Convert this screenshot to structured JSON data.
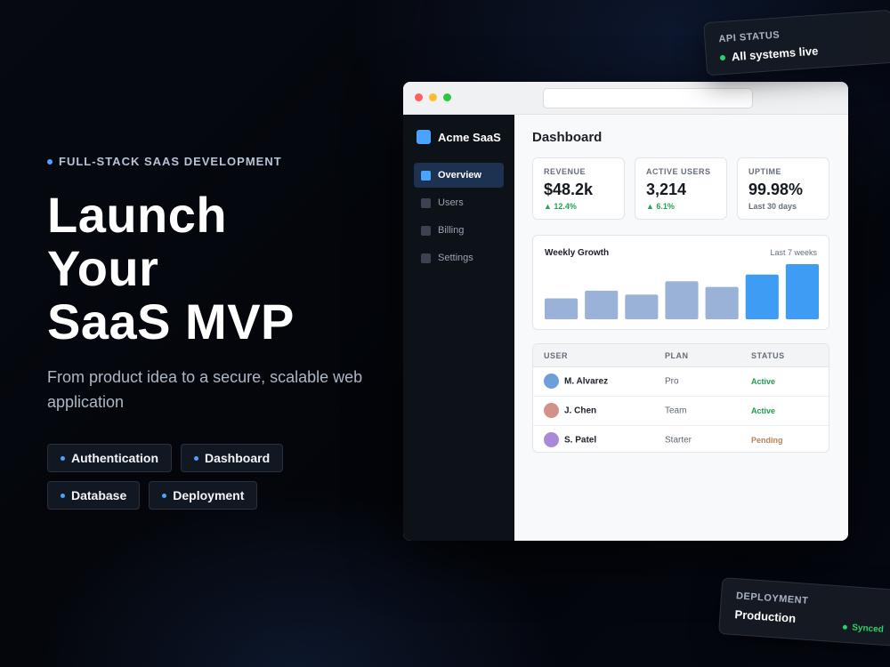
{
  "hero": {
    "eyebrow": "FULL-STACK SAAS DEVELOPMENT",
    "headline": [
      "Launch",
      "Your",
      "SaaS MVP"
    ],
    "subtitle": "From product idea to a secure, scalable web application",
    "chips": [
      "Authentication",
      "Dashboard",
      "Database",
      "Deployment"
    ]
  },
  "app": {
    "brand": "Acme SaaS",
    "nav": [
      {
        "label": "Overview",
        "icon": "overview-icon",
        "active": true
      },
      {
        "label": "Users",
        "icon": "users-icon",
        "active": false
      },
      {
        "label": "Billing",
        "icon": "billing-icon",
        "active": false
      },
      {
        "label": "Settings",
        "icon": "settings-icon",
        "active": false
      }
    ],
    "title": "Dashboard",
    "stats": [
      {
        "label": "REVENUE",
        "value": "$48.2k",
        "delta": "▲ 12.4%"
      },
      {
        "label": "ACTIVE USERS",
        "value": "3,214",
        "delta": "▲ 6.1%"
      },
      {
        "label": "UPTIME",
        "value": "99.98%",
        "delta": "Last 30 days"
      }
    ],
    "growth": {
      "title": "Weekly Growth",
      "range": "Last 7 weeks"
    },
    "table": {
      "headers": [
        "USER",
        "PLAN",
        "STATUS"
      ],
      "rows": [
        {
          "user": "M. Alvarez",
          "plan": "Pro",
          "status": "Active",
          "avatar_color": "#6f9fd8",
          "status_color": "#1f9b4f"
        },
        {
          "user": "J. Chen",
          "plan": "Team",
          "status": "Active",
          "avatar_color": "#d4908a",
          "status_color": "#1f9b4f"
        },
        {
          "user": "S. Patel",
          "plan": "Starter",
          "status": "Pending",
          "avatar_color": "#a98ad8",
          "status_color": "#b5835a"
        }
      ]
    }
  },
  "chart_data": {
    "type": "bar",
    "values": [
      22,
      30,
      26,
      40,
      34,
      47,
      58
    ],
    "highlight_from_index": 5,
    "colors": {
      "normal": "#9bb2d8",
      "highlight": "#3f9cf5"
    }
  },
  "cards": {
    "api": {
      "label": "API STATUS",
      "text": "All systems live"
    },
    "deploy": {
      "label": "DEPLOYMENT",
      "value": "Production",
      "status": "Synced"
    }
  },
  "colors": {
    "accent": "#4aa3ff",
    "success": "#2bd16b"
  }
}
